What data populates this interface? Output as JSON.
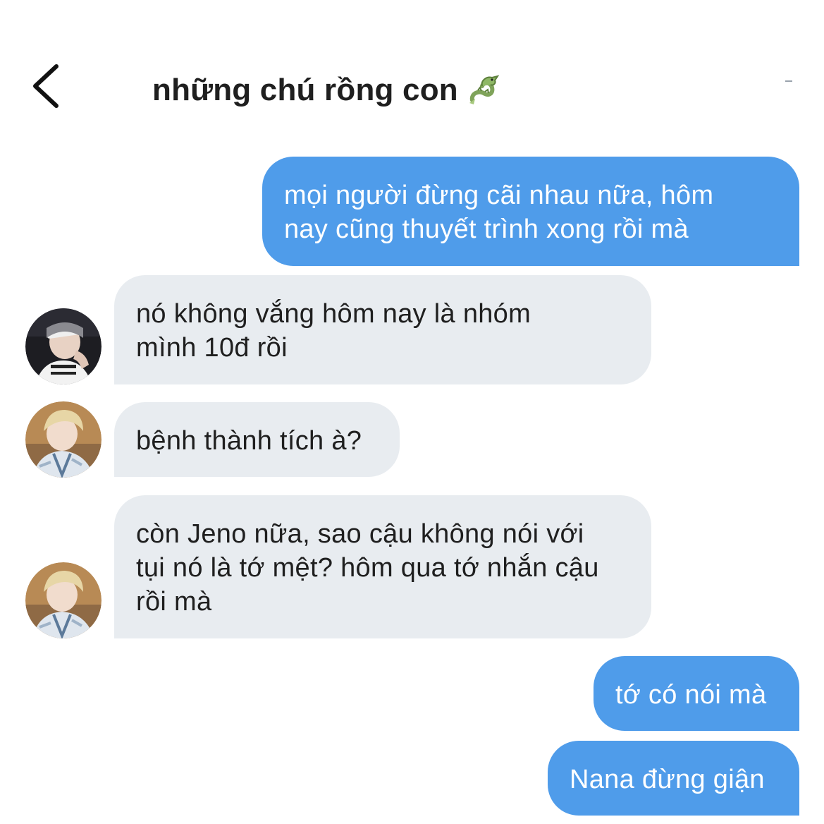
{
  "header": {
    "title": "những chú rồng con",
    "back_icon": "chevron-left-icon",
    "title_emoji_icon": "dragon-icon"
  },
  "colors": {
    "outgoing_bubble": "#4f9cea",
    "incoming_bubble": "#e8ecf0",
    "outgoing_text": "#ffffff",
    "incoming_text": "#1f1f1f"
  },
  "messages": [
    {
      "direction": "out",
      "lines": [
        "mọi người đừng cãi nhau nữa, hôm",
        "nay cũng thuyết trình xong rồi mà"
      ]
    },
    {
      "direction": "in",
      "sender_avatar": "avatar-1",
      "lines": [
        "nó không vắng hôm nay là nhóm",
        "mình 10đ rồi"
      ]
    },
    {
      "direction": "in",
      "sender_avatar": "avatar-2",
      "lines": [
        "bệnh thành tích à?"
      ]
    },
    {
      "direction": "in",
      "sender_avatar": "avatar-2",
      "lines": [
        "còn Jeno nữa, sao cậu không nói với",
        "tụi nó là tớ mệt? hôm qua tớ nhắn cậu",
        "rồi mà"
      ]
    },
    {
      "direction": "out",
      "lines": [
        "tớ có nói mà"
      ]
    },
    {
      "direction": "out",
      "lines": [
        "Nana đừng giận"
      ]
    }
  ]
}
